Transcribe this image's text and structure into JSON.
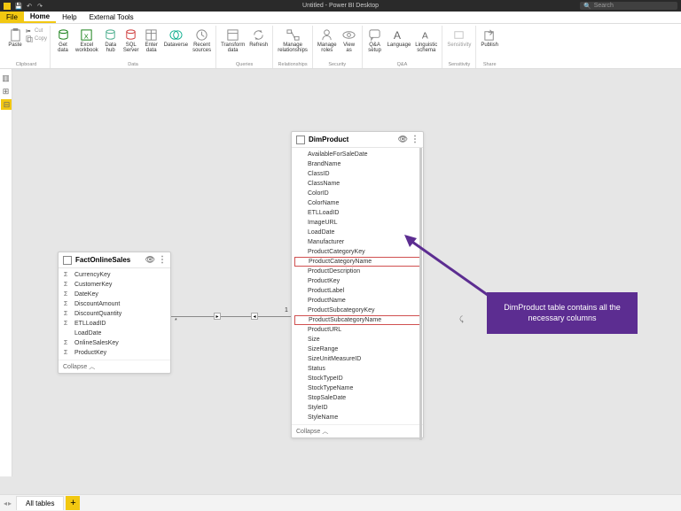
{
  "titlebar": {
    "title": "Untitled - Power BI Desktop",
    "search_placeholder": "Search"
  },
  "menu": {
    "file": "File",
    "home": "Home",
    "help": "Help",
    "external": "External Tools"
  },
  "ribbon": {
    "clipboard": {
      "paste": "Paste",
      "cut": "Cut",
      "copy": "Copy",
      "label": "Clipboard"
    },
    "data": {
      "get": "Get\ndata",
      "excel": "Excel\nworkbook",
      "hub": "Data\nhub",
      "sql": "SQL\nServer",
      "enter": "Enter\ndata",
      "dataverse": "Dataverse",
      "recent": "Recent\nsources",
      "label": "Data"
    },
    "queries": {
      "transform": "Transform\ndata",
      "refresh": "Refresh",
      "label": "Queries"
    },
    "rel": {
      "manage": "Manage\nrelationships",
      "label": "Relationships"
    },
    "sec": {
      "roles": "Manage\nroles",
      "view": "View\nas",
      "label": "Security"
    },
    "qa": {
      "qa": "Q&A\nsetup",
      "lang": "Language",
      "schema": "Linguistic\nschema",
      "label": "Q&A"
    },
    "sens": {
      "sens": "Sensitivity",
      "label": "Sensitivity"
    },
    "share": {
      "publish": "Publish",
      "label": "Share"
    }
  },
  "fact": {
    "name": "FactOnlineSales",
    "fields": [
      "CurrencyKey",
      "CustomerKey",
      "DateKey",
      "DiscountAmount",
      "DiscountQuantity",
      "ETLLoadID",
      "LoadDate",
      "OnlineSalesKey",
      "ProductKey"
    ],
    "sigma": [
      0,
      1,
      2,
      3,
      4,
      5,
      7,
      8
    ],
    "collapse": "Collapse"
  },
  "dim": {
    "name": "DimProduct",
    "fields": [
      "AvailableForSaleDate",
      "BrandName",
      "ClassID",
      "ClassName",
      "ColorID",
      "ColorName",
      "ETLLoadID",
      "ImageURL",
      "LoadDate",
      "Manufacturer",
      "ProductCategoryKey",
      "ProductCategoryName",
      "ProductDescription",
      "ProductKey",
      "ProductLabel",
      "ProductName",
      "ProductSubcategoryKey",
      "ProductSubcategoryName",
      "ProductURL",
      "Size",
      "SizeRange",
      "SizeUnitMeasureID",
      "Status",
      "StockTypeID",
      "StockTypeName",
      "StopSaleDate",
      "StyleID",
      "StyleName"
    ],
    "highlight": [
      11,
      17
    ],
    "collapse": "Collapse"
  },
  "callout": "DimProduct table contains all the necessary columns",
  "tabs": {
    "all": "All tables"
  },
  "rel": {
    "many": "*",
    "one": "1"
  }
}
